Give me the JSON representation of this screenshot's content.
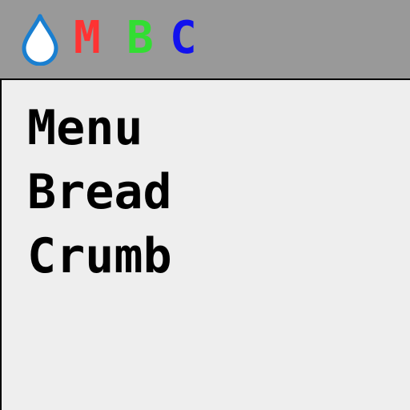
{
  "header": {
    "logo_letters": [
      {
        "text": "M",
        "color": "#ff3333"
      },
      {
        "text": "B",
        "color": "#33dd33"
      },
      {
        "text": "C",
        "color": "#1111ee"
      }
    ],
    "icon": "water-drop-icon",
    "icon_color": "#1a7fd0",
    "background": "#999999"
  },
  "content": {
    "lines": [
      "Menu",
      "Bread",
      "Crumb"
    ],
    "background": "#eeeeee"
  }
}
